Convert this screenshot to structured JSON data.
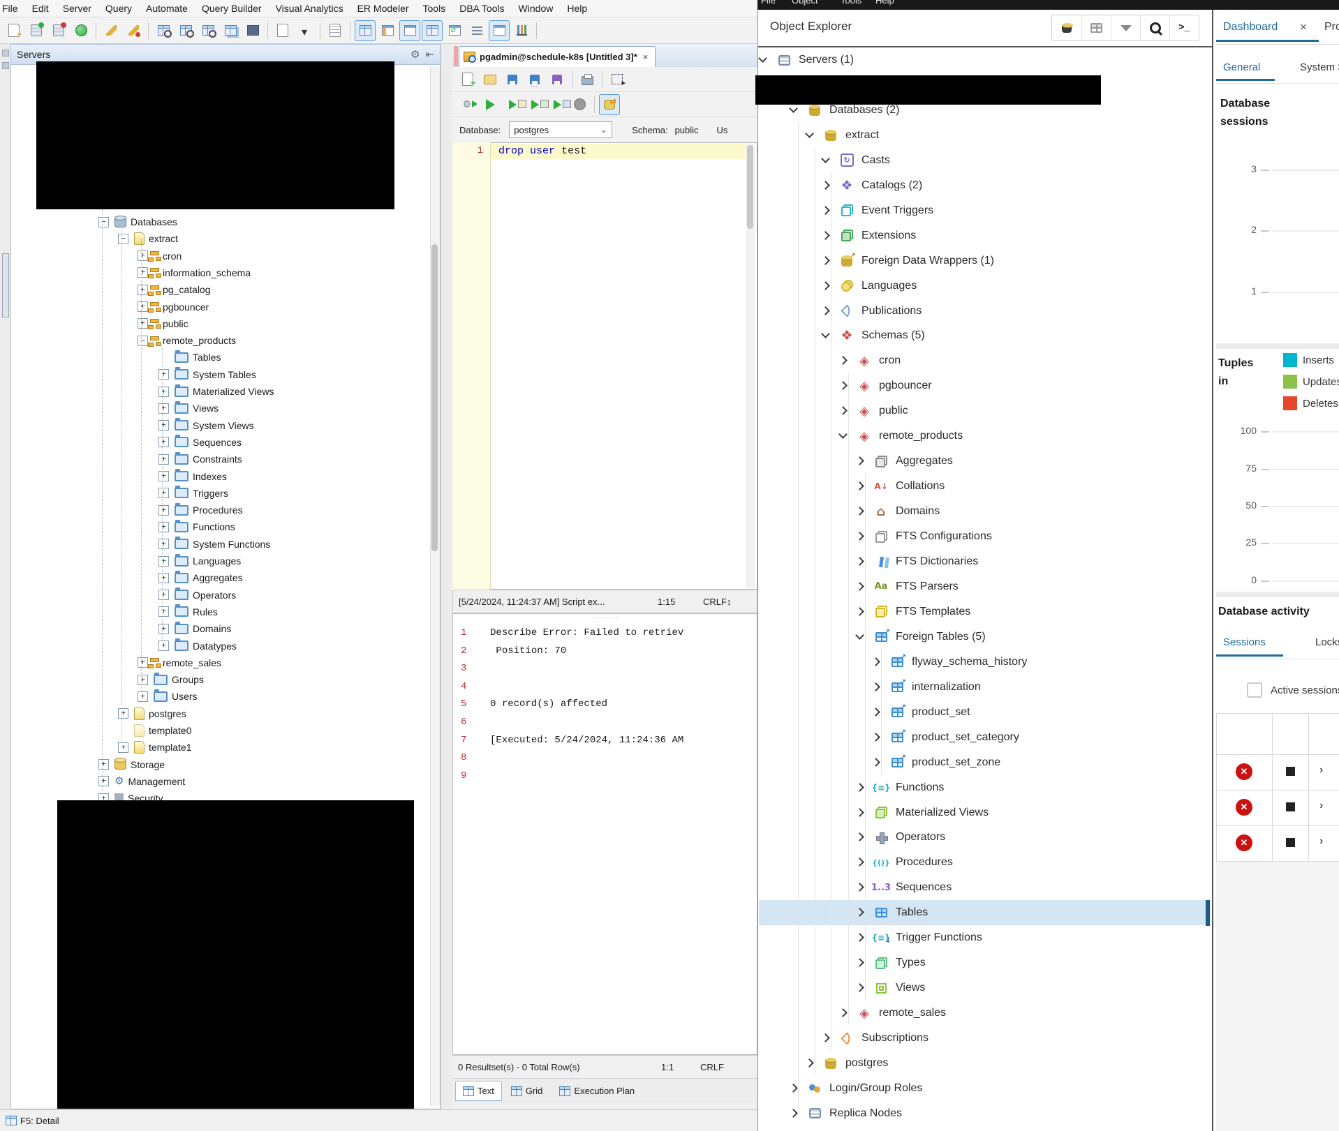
{
  "colors": {
    "pgadmin_blue": "#1f6b9e",
    "selection": "#d4e6f4",
    "insert_cyan": "#00b5cc",
    "update_green": "#8bc34a",
    "delete_red": "#e5472d",
    "error_red": "#cc1111"
  },
  "left_app": {
    "menu": [
      "File",
      "Edit",
      "Server",
      "Query",
      "Automate",
      "Query Builder",
      "Visual Analytics",
      "ER Modeler",
      "Tools",
      "DBA Tools",
      "Window",
      "Help"
    ],
    "toolbar": [
      "doc-plus",
      "server-green",
      "server-red",
      "globe-green",
      "|",
      "broom",
      "broom-pin",
      "|",
      "table-search",
      "table-search",
      "table-search",
      "table-copy",
      "table-dark",
      "|",
      "doc",
      "dropdown",
      "|",
      "doc-list",
      "|",
      "grid*",
      "window-orange",
      "window-yellow*",
      "grid-blue*",
      "window-arrows",
      "list",
      "window-split*",
      "chart-bars",
      "|"
    ],
    "servers_panel": {
      "title": "Servers",
      "gear_icon": "⚙",
      "pin_icon": "⇤"
    },
    "tree": [
      {
        "label": "Databases",
        "lvl": 1,
        "exp": "m",
        "icon": "databases"
      },
      {
        "label": "extract",
        "lvl": 2,
        "exp": "m",
        "icon": "db"
      },
      {
        "label": "cron",
        "lvl": 3,
        "exp": "p",
        "icon": "schema"
      },
      {
        "label": "information_schema",
        "lvl": 3,
        "exp": "p",
        "icon": "schema"
      },
      {
        "label": "pg_catalog",
        "lvl": 3,
        "exp": "p",
        "icon": "schema"
      },
      {
        "label": "pgbouncer",
        "lvl": 3,
        "exp": "p",
        "icon": "schema"
      },
      {
        "label": "public",
        "lvl": 3,
        "exp": "p",
        "icon": "schema"
      },
      {
        "label": "remote_products",
        "lvl": 3,
        "exp": "m",
        "icon": "schema"
      },
      {
        "label": "Tables",
        "lvl": 4,
        "exp": "n",
        "icon": "folder"
      },
      {
        "label": "System Tables",
        "lvl": 4,
        "exp": "p",
        "icon": "folder"
      },
      {
        "label": "Materialized Views",
        "lvl": 4,
        "exp": "p",
        "icon": "folder"
      },
      {
        "label": "Views",
        "lvl": 4,
        "exp": "p",
        "icon": "folder"
      },
      {
        "label": "System Views",
        "lvl": 4,
        "exp": "p",
        "icon": "folder"
      },
      {
        "label": "Sequences",
        "lvl": 4,
        "exp": "p",
        "icon": "folder"
      },
      {
        "label": "Constraints",
        "lvl": 4,
        "exp": "p",
        "icon": "folder"
      },
      {
        "label": "Indexes",
        "lvl": 4,
        "exp": "p",
        "icon": "folder"
      },
      {
        "label": "Triggers",
        "lvl": 4,
        "exp": "p",
        "icon": "folder"
      },
      {
        "label": "Procedures",
        "lvl": 4,
        "exp": "p",
        "icon": "folder"
      },
      {
        "label": "Functions",
        "lvl": 4,
        "exp": "p",
        "icon": "folder"
      },
      {
        "label": "System Functions",
        "lvl": 4,
        "exp": "p",
        "icon": "folder"
      },
      {
        "label": "Languages",
        "lvl": 4,
        "exp": "p",
        "icon": "folder"
      },
      {
        "label": "Aggregates",
        "lvl": 4,
        "exp": "p",
        "icon": "folder"
      },
      {
        "label": "Operators",
        "lvl": 4,
        "exp": "p",
        "icon": "folder"
      },
      {
        "label": "Rules",
        "lvl": 4,
        "exp": "p",
        "icon": "folder"
      },
      {
        "label": "Domains",
        "lvl": 4,
        "exp": "p",
        "icon": "folder"
      },
      {
        "label": "Datatypes",
        "lvl": 4,
        "exp": "p",
        "icon": "folder"
      },
      {
        "label": "remote_sales",
        "lvl": 3,
        "exp": "p",
        "icon": "schema"
      },
      {
        "label": "Groups",
        "lvl": 3,
        "exp": "p",
        "icon": "folder"
      },
      {
        "label": "Users",
        "lvl": 3,
        "exp": "p",
        "icon": "folder"
      },
      {
        "label": "postgres",
        "lvl": 2,
        "exp": "p",
        "icon": "db"
      },
      {
        "label": "template0",
        "lvl": 2,
        "exp": "n",
        "icon": "db-pale"
      },
      {
        "label": "template1",
        "lvl": 2,
        "exp": "p",
        "icon": "db"
      },
      {
        "label": "Storage",
        "lvl": 1,
        "exp": "p",
        "icon": "storage"
      },
      {
        "label": "Management",
        "lvl": 1,
        "exp": "p",
        "icon": "management"
      },
      {
        "label": "Security",
        "lvl": 1,
        "exp": "p",
        "icon": "security"
      }
    ],
    "query_window": {
      "tab_title": "pgadmin@schedule-k8s [Untitled 3]*",
      "tab_close": "×",
      "toolbar1": [
        "doc-new",
        "folder-open",
        "save",
        "save-all",
        "save-purple",
        "|",
        "print",
        "|",
        "marquee"
      ],
      "toolbar2": [
        "gear-play",
        "play",
        "play-doc",
        "play-edit",
        "play-grid",
        "stop",
        "|",
        "db-sync*"
      ],
      "database_label": "Database:",
      "database_value": "postgres",
      "schema_label": "Schema:",
      "schema_value": "public",
      "use_label": "Us",
      "editor": {
        "line_number": "1",
        "tokens": [
          {
            "t": "drop",
            "k": true
          },
          {
            "t": " ",
            "k": false
          },
          {
            "t": "user",
            "k": true
          },
          {
            "t": " ",
            "k": false
          },
          {
            "t": "test",
            "k": false
          }
        ]
      },
      "script_status": {
        "message": "[5/24/2024, 11:24:37 AM] Script ex...",
        "caret": "1:15",
        "eol": "CRLF",
        "eol_arrows": "↕"
      },
      "messages": [
        {
          "n": "1",
          "text": "Describe Error: Failed to retriev"
        },
        {
          "n": "2",
          "text": " Position: 70"
        },
        {
          "n": "3",
          "text": ""
        },
        {
          "n": "4",
          "text": ""
        },
        {
          "n": "5",
          "text": "0 record(s) affected"
        },
        {
          "n": "6",
          "text": ""
        },
        {
          "n": "7",
          "text": "[Executed: 5/24/2024, 11:24:36 AM"
        },
        {
          "n": "8",
          "text": ""
        },
        {
          "n": "9",
          "text": ""
        }
      ],
      "results_status": {
        "left": "0 Resultset(s) - 0 Total Row(s)",
        "caret": "1:1",
        "eol": "CRLF"
      },
      "result_tabs": [
        {
          "label": "Text",
          "active": true
        },
        {
          "label": "Grid",
          "active": false
        },
        {
          "label": "Execution Plan",
          "active": false
        }
      ]
    },
    "f5_status": "F5: Detail"
  },
  "right_app": {
    "menu": [
      "File",
      "Object",
      "Tools",
      "Help"
    ],
    "object_explorer": {
      "title": "Object Explorer",
      "toolbar": [
        "database-icon",
        "grid-icon",
        "filter-icon",
        "search-icon",
        "terminal-icon"
      ],
      "tree": [
        {
          "label": "Servers (1)",
          "lvl": 0,
          "chev": "d",
          "icon": "server"
        },
        {
          "label": "",
          "lvl": 1,
          "chev": "n",
          "icon": "",
          "redacted": true
        },
        {
          "label": "Databases (2)",
          "lvl": 1,
          "chev": "d",
          "icon": "databases"
        },
        {
          "label": "extract",
          "lvl": 2,
          "chev": "d",
          "icon": "database"
        },
        {
          "label": "Casts",
          "lvl": 3,
          "chev": "d",
          "icon": "casts"
        },
        {
          "label": "Catalogs (2)",
          "lvl": 3,
          "chev": "r",
          "icon": "catalogs"
        },
        {
          "label": "Event Triggers",
          "lvl": 3,
          "chev": "r",
          "icon": "event-triggers"
        },
        {
          "label": "Extensions",
          "lvl": 3,
          "chev": "r",
          "icon": "extensions"
        },
        {
          "label": "Foreign Data Wrappers (1)",
          "lvl": 3,
          "chev": "r",
          "icon": "fdw"
        },
        {
          "label": "Languages",
          "lvl": 3,
          "chev": "r",
          "icon": "languages"
        },
        {
          "label": "Publications",
          "lvl": 3,
          "chev": "r",
          "icon": "publications"
        },
        {
          "label": "Schemas (5)",
          "lvl": 3,
          "chev": "d",
          "icon": "schemas"
        },
        {
          "label": "cron",
          "lvl": 4,
          "chev": "r",
          "icon": "schema"
        },
        {
          "label": "pgbouncer",
          "lvl": 4,
          "chev": "r",
          "icon": "schema"
        },
        {
          "label": "public",
          "lvl": 4,
          "chev": "r",
          "icon": "schema"
        },
        {
          "label": "remote_products",
          "lvl": 4,
          "chev": "d",
          "icon": "schema"
        },
        {
          "label": "Aggregates",
          "lvl": 5,
          "chev": "r",
          "icon": "aggregates"
        },
        {
          "label": "Collations",
          "lvl": 5,
          "chev": "r",
          "icon": "collations"
        },
        {
          "label": "Domains",
          "lvl": 5,
          "chev": "r",
          "icon": "domains"
        },
        {
          "label": "FTS Configurations",
          "lvl": 5,
          "chev": "r",
          "icon": "fts-configurations"
        },
        {
          "label": "FTS Dictionaries",
          "lvl": 5,
          "chev": "r",
          "icon": "fts-dictionaries"
        },
        {
          "label": "FTS Parsers",
          "lvl": 5,
          "chev": "r",
          "icon": "fts-parsers"
        },
        {
          "label": "FTS Templates",
          "lvl": 5,
          "chev": "r",
          "icon": "fts-templates"
        },
        {
          "label": "Foreign Tables (5)",
          "lvl": 5,
          "chev": "d",
          "icon": "foreign-tables"
        },
        {
          "label": "flyway_schema_history",
          "lvl": 6,
          "chev": "r",
          "icon": "foreign-table"
        },
        {
          "label": "internalization",
          "lvl": 6,
          "chev": "r",
          "icon": "foreign-table"
        },
        {
          "label": "product_set",
          "lvl": 6,
          "chev": "r",
          "icon": "foreign-table"
        },
        {
          "label": "product_set_category",
          "lvl": 6,
          "chev": "r",
          "icon": "foreign-table"
        },
        {
          "label": "product_set_zone",
          "lvl": 6,
          "chev": "r",
          "icon": "foreign-table"
        },
        {
          "label": "Functions",
          "lvl": 5,
          "chev": "r",
          "icon": "functions"
        },
        {
          "label": "Materialized Views",
          "lvl": 5,
          "chev": "r",
          "icon": "materialized-views"
        },
        {
          "label": "Operators",
          "lvl": 5,
          "chev": "r",
          "icon": "operators"
        },
        {
          "label": "Procedures",
          "lvl": 5,
          "chev": "r",
          "icon": "procedures"
        },
        {
          "label": "Sequences",
          "lvl": 5,
          "chev": "r",
          "icon": "sequences"
        },
        {
          "label": "Tables",
          "lvl": 5,
          "chev": "r",
          "icon": "tables",
          "selected": true
        },
        {
          "label": "Trigger Functions",
          "lvl": 5,
          "chev": "r",
          "icon": "trigger-functions"
        },
        {
          "label": "Types",
          "lvl": 5,
          "chev": "r",
          "icon": "types"
        },
        {
          "label": "Views",
          "lvl": 5,
          "chev": "r",
          "icon": "views"
        },
        {
          "label": "remote_sales",
          "lvl": 4,
          "chev": "r",
          "icon": "schema"
        },
        {
          "label": "Subscriptions",
          "lvl": 3,
          "chev": "r",
          "icon": "subscriptions"
        },
        {
          "label": "postgres",
          "lvl": 2,
          "chev": "r",
          "icon": "database"
        },
        {
          "label": "Login/Group Roles",
          "lvl": 1,
          "chev": "r",
          "icon": "roles"
        },
        {
          "label": "Replica Nodes",
          "lvl": 1,
          "chev": "r",
          "icon": "replica"
        }
      ]
    },
    "dashboard": {
      "tab": "Dashboard",
      "tab_close": "×",
      "tab_next": "Processes",
      "subtab_active": "General",
      "subtab_next": "System Statistics",
      "sessions_chart": {
        "title_line1": "Database",
        "title_line2": "sessions",
        "y_ticks": [
          "3",
          "2",
          "1"
        ]
      },
      "tuples_chart": {
        "title_line1": "Tuples",
        "title_line2": "in",
        "legend": [
          {
            "label": "Inserts",
            "color": "#00b5cc"
          },
          {
            "label": "Updates",
            "color": "#8bc34a"
          },
          {
            "label": "Deletes",
            "color": "#e5472d"
          }
        ],
        "y_ticks": [
          "100",
          "75",
          "50",
          "25",
          "0"
        ]
      },
      "activity": {
        "title": "Database activity",
        "tab_active": "Sessions",
        "tab_next": "Locks",
        "checkbox_label": "Active sessions only",
        "rows": [
          {
            "icons": [
              "cancel",
              "stop",
              "expand"
            ]
          },
          {
            "icons": [
              "cancel",
              "stop",
              "expand"
            ]
          },
          {
            "icons": [
              "cancel",
              "stop",
              "expand"
            ]
          }
        ]
      }
    }
  }
}
